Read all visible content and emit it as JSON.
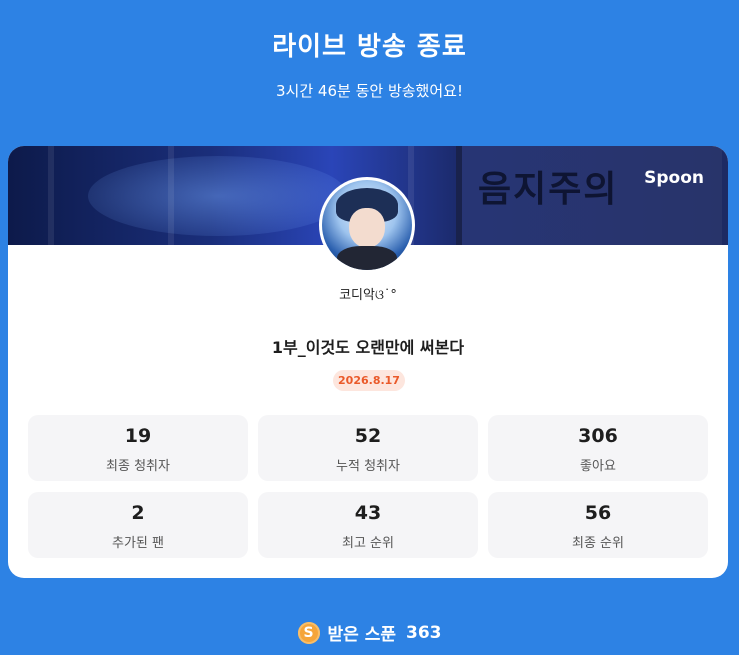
{
  "header": {
    "title": "라이브 방송 종료",
    "subtitle": "3시간 46분 동안 방송했어요!"
  },
  "card": {
    "brand": "Spoon",
    "banner_sign_text": "음지주의",
    "nickname": "코디악ଓ˙°",
    "stream_title": "1부_이것도 오랜만에 써본다",
    "date": "2026.8.17",
    "stats": [
      {
        "value": "19",
        "label": "최종 청취자"
      },
      {
        "value": "52",
        "label": "누적 청취자"
      },
      {
        "value": "306",
        "label": "좋아요"
      },
      {
        "value": "2",
        "label": "추가된 팬"
      },
      {
        "value": "43",
        "label": "최고 순위"
      },
      {
        "value": "56",
        "label": "최종 순위"
      }
    ]
  },
  "footer": {
    "coin_symbol": "S",
    "label": "받은 스푼",
    "count": "363"
  },
  "colors": {
    "background": "#2d82e4",
    "card": "#ffffff",
    "stat_tile": "#f5f5f7",
    "date_badge_bg": "#fde6de",
    "date_badge_text": "#ea5a2a",
    "coin": "#f5a53a"
  }
}
